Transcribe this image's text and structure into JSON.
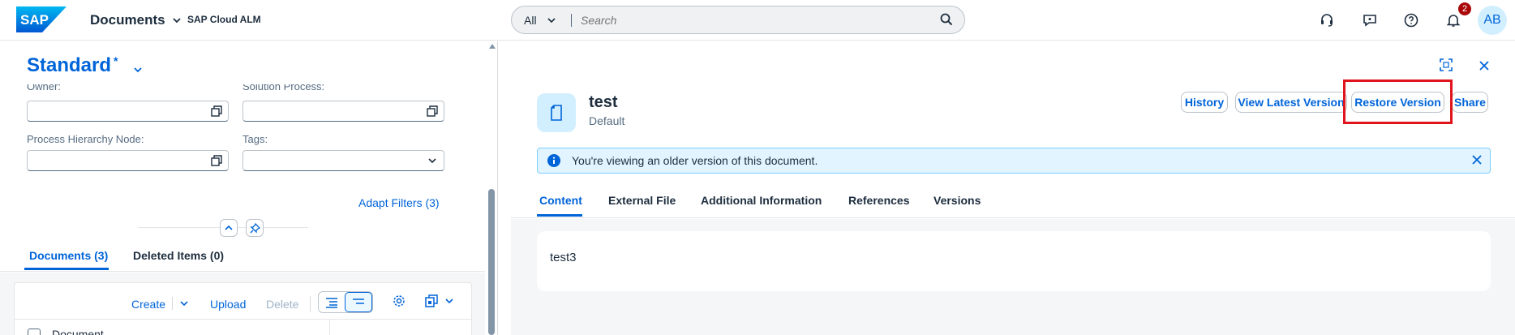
{
  "shell": {
    "logo_text": "SAP",
    "app_title": "Documents",
    "app_subtitle": "SAP Cloud ALM",
    "search": {
      "scope": "All",
      "placeholder": "Search"
    },
    "notification_count": "2",
    "avatar_initials": "AB"
  },
  "filters": {
    "variant_name": "Standard",
    "variant_modified": "*",
    "owner_label": "Owner:",
    "solution_process_label": "Solution Process:",
    "process_hierarchy_label": "Process Hierarchy Node:",
    "tags_label": "Tags:",
    "adapt_filters": "Adapt Filters (3)"
  },
  "left_tabs": [
    {
      "label": "Documents (3)",
      "active": true
    },
    {
      "label": "Deleted Items (0)",
      "active": false
    }
  ],
  "toolbar": {
    "create": "Create",
    "upload": "Upload",
    "delete": "Delete"
  },
  "table": {
    "column_document": "Document"
  },
  "document": {
    "title": "test",
    "subtitle": "Default",
    "actions": [
      "History",
      "View Latest Version",
      "Restore Version",
      "Share"
    ]
  },
  "info_strip": {
    "message": "You're viewing an older version of this document."
  },
  "right_tabs": [
    {
      "label": "Content",
      "active": true
    },
    {
      "label": "External File",
      "active": false
    },
    {
      "label": "Additional Information",
      "active": false
    },
    {
      "label": "References",
      "active": false
    },
    {
      "label": "Versions",
      "active": false
    }
  ],
  "content": {
    "text": "test3"
  },
  "colors": {
    "brand": "#0064d9",
    "highlight": "#e0141d",
    "info_bg": "#e1f4ff"
  }
}
